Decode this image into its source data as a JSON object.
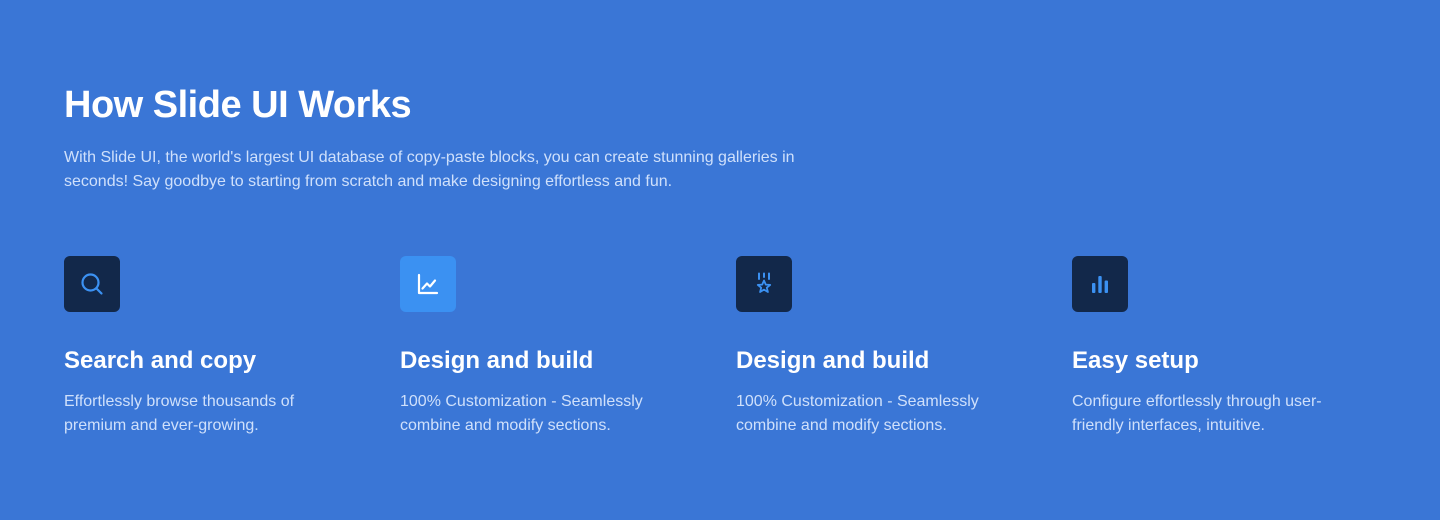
{
  "section": {
    "title": "How Slide UI Works",
    "description": "With Slide UI, the world's largest UI database of copy-paste blocks, you can create stunning galleries in seconds! Say goodbye to starting from scratch and make designing effortless and fun."
  },
  "features": [
    {
      "icon": "search-icon",
      "title": "Search and copy",
      "description": "Effortlessly browse thousands of premium and ever-growing."
    },
    {
      "icon": "line-chart-icon",
      "title": "Design and build",
      "description": "100% Customization - Seamlessly combine and modify sections."
    },
    {
      "icon": "medal-star-icon",
      "title": "Design and build",
      "description": "100% Customization - Seamlessly combine and modify sections."
    },
    {
      "icon": "bar-chart-icon",
      "title": "Easy setup",
      "description": "Configure effortlessly through user-friendly interfaces, intuitive."
    }
  ],
  "colors": {
    "background": "#3a76d6",
    "icon_box_dark": "#12284a",
    "icon_box_accent": "#3b91f2",
    "icon_stroke_blue": "#3b91f2",
    "body_text": "#cfe0fb",
    "heading_text": "#ffffff"
  }
}
